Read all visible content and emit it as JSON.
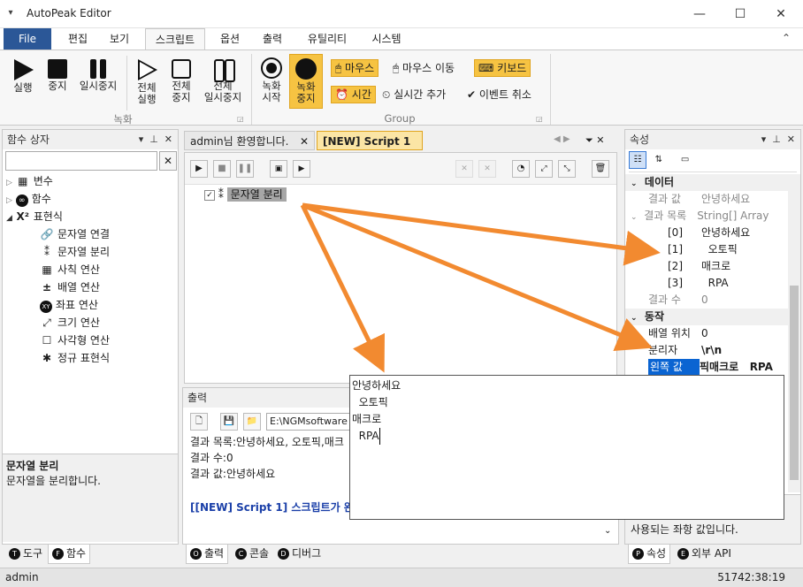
{
  "window": {
    "title": "AutoPeak Editor",
    "minimize": "—",
    "maximize": "☐",
    "close": "✕",
    "collapse_ribbon": "⌃"
  },
  "ribbon_tabs": [
    "File",
    "편집",
    "보기",
    "스크립트",
    "옵션",
    "출력",
    "유틸리티",
    "시스템"
  ],
  "ribbon": {
    "run": "실행",
    "stop": "중지",
    "pause": "일시중지",
    "all_run": [
      "전체",
      "실행"
    ],
    "all_stop": [
      "전체",
      "중지"
    ],
    "all_pause": [
      "전체",
      "일시중지"
    ],
    "rec_start": [
      "녹화",
      "시작"
    ],
    "rec_stop": [
      "녹화",
      "중지"
    ],
    "mouse": "마우스",
    "mouse_move": "마우스 이동",
    "keyboard": "키보드",
    "time": "시간",
    "realtime_add": "실시간 추가",
    "event_cancel": "이벤트 취소",
    "group_record": "녹화",
    "group_group": "Group"
  },
  "function_box": {
    "title": "함수 상자",
    "clear": "✕",
    "items": [
      {
        "label": "변수",
        "icon": "variable-icon",
        "glyph": "▦"
      },
      {
        "label": "함수",
        "icon": "function-icon",
        "glyph": "∞"
      },
      {
        "label": "표현식",
        "icon": "expression-icon",
        "glyph": "X²"
      }
    ],
    "children": [
      {
        "label": "문자열 연결",
        "icon": "link-icon",
        "glyph": "🔗"
      },
      {
        "label": "문자열 분리",
        "icon": "split-icon",
        "glyph": "⁑"
      },
      {
        "label": "사칙 연산",
        "icon": "arithmetic-icon",
        "glyph": "▦"
      },
      {
        "label": "배열 연산",
        "icon": "array-icon",
        "glyph": "±"
      },
      {
        "label": "좌표 연산",
        "icon": "xy-icon",
        "glyph": "XY"
      },
      {
        "label": "크기 연산",
        "icon": "resize-icon",
        "glyph": "⤢"
      },
      {
        "label": "사각형 연산",
        "icon": "rectangle-icon",
        "glyph": "☐"
      },
      {
        "label": "정규 표현식",
        "icon": "regex-icon",
        "glyph": "✱"
      }
    ],
    "desc_title": "문자열 분리",
    "desc_text": "문자열을 분리합니다.",
    "bottom_tabs": [
      {
        "letter": "T",
        "label": "도구"
      },
      {
        "letter": "F",
        "label": "함수"
      }
    ]
  },
  "doc_tabs": [
    {
      "label": "admin님 환영합니다."
    },
    {
      "label": "[NEW] Script 1"
    }
  ],
  "script": {
    "node_label": "문자열 분리"
  },
  "output": {
    "title": "출력",
    "path": "E:\\NGMsoftware",
    "lines": [
      "결과 목록:안녕하세요,  오토픽,매크",
      "결과 수:0",
      "결과 값:안녕하세요"
    ],
    "done_line": "[[NEW] Script 1] 스크립트가 완료",
    "bottom_tabs": [
      {
        "letter": "O",
        "label": "출력"
      },
      {
        "letter": "C",
        "label": "콘솔"
      },
      {
        "letter": "D",
        "label": "디버그"
      }
    ]
  },
  "popup": {
    "lines": [
      "안녕하세요",
      "  오토픽",
      "매크로",
      "  RPA"
    ]
  },
  "properties": {
    "title": "속성",
    "cat_data": "데이터",
    "result_value": {
      "key": "결과 값",
      "value": "안녕하세요"
    },
    "result_list": {
      "key": "결과 목록",
      "value": "String[] Array"
    },
    "items": [
      {
        "k": "[0]",
        "v": "안녕하세요"
      },
      {
        "k": "[1]",
        "v": "  오토픽"
      },
      {
        "k": "[2]",
        "v": "매크로"
      },
      {
        "k": "[3]",
        "v": "  RPA"
      }
    ],
    "result_count": {
      "key": "결과 수",
      "value": "0"
    },
    "cat_action": "동작",
    "array_pos": {
      "key": "배열 위치",
      "value": "0"
    },
    "separator": {
      "key": "분리자",
      "value": "\\r\\n"
    },
    "left_value": {
      "key": "왼쪽 값",
      "value": "픽매크로   RPA"
    },
    "desc_text": [
      "사용되는 좌항 값입니다."
    ],
    "bottom_tabs": [
      {
        "letter": "P",
        "label": "속성"
      },
      {
        "letter": "E",
        "label": "외부 API"
      }
    ]
  },
  "status": {
    "user": "admin",
    "clock": "51742:38:19"
  },
  "colors": {
    "accent": "#2b5797",
    "highlight": "#f6c342",
    "arrow": "#f28a30",
    "selection": "#0a64d2"
  }
}
